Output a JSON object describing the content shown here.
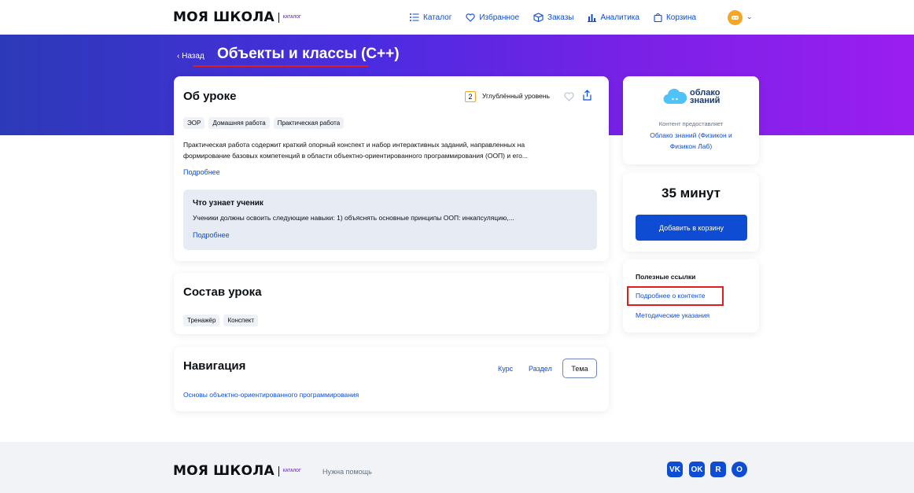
{
  "header": {
    "logo": "МОЯ ШКОЛА",
    "logo_sub": "каталог",
    "nav": [
      {
        "label": "Каталог",
        "icon": "list-icon"
      },
      {
        "label": "Избранное",
        "icon": "heart-icon"
      },
      {
        "label": "Заказы",
        "icon": "box-icon"
      },
      {
        "label": "Аналитика",
        "icon": "bar-chart-icon"
      },
      {
        "label": "Корзина",
        "icon": "bag-icon"
      }
    ]
  },
  "hero": {
    "back_label": "‹ Назад",
    "title": "Объекты и классы (С++)"
  },
  "about": {
    "title": "Об уроке",
    "level_number": "2",
    "level_label": "Углублённый уровень",
    "tags": [
      "ЭОР",
      "Домашняя работа",
      "Практическая работа"
    ],
    "description_line1": "Практическая работа содержит краткий опорный конспект и набор интерактивных заданий, направленных на",
    "description_line2": "формирование базовых компетенций в области объектно-ориентированного программирования (ООП) и его...",
    "more_label": "Подробнее",
    "learn_title": "Что узнает ученик",
    "learn_text": "Ученики должны освоить следующие навыки: 1) объяснять основные принципы ООП: инкапсуляцию,...",
    "learn_more": "Подробнее"
  },
  "composition": {
    "title": "Состав урока",
    "tags": [
      "Тренажёр",
      "Конспект"
    ]
  },
  "navigation": {
    "title": "Навигация",
    "tabs": [
      "Курс",
      "Раздел",
      "Тема"
    ],
    "active_tab": "Тема",
    "link": "Основы объектно-ориентированного программирования"
  },
  "provider": {
    "logo_line1": "облако",
    "logo_line2": "знаний",
    "caption": "Контент предоставляет",
    "name_line1": "Облако знаний (Физикон и",
    "name_line2": "Физикон Лаб)"
  },
  "purchase": {
    "duration": "35 минут",
    "button": "Добавить в корзину"
  },
  "links": {
    "title": "Полезные ссылки",
    "items": [
      "Подробнее о контенте",
      "Методические указания"
    ]
  },
  "footer": {
    "logo": "МОЯ ШКОЛА",
    "logo_sub": "каталог",
    "help": "Нужна помощь",
    "social": [
      "VK",
      "OK",
      "R",
      "O"
    ]
  },
  "colors": {
    "accent": "#0d4cd3",
    "highlight": "#e21c1c",
    "hero_start": "#2c3ab8",
    "hero_end": "#9b1ef0"
  }
}
